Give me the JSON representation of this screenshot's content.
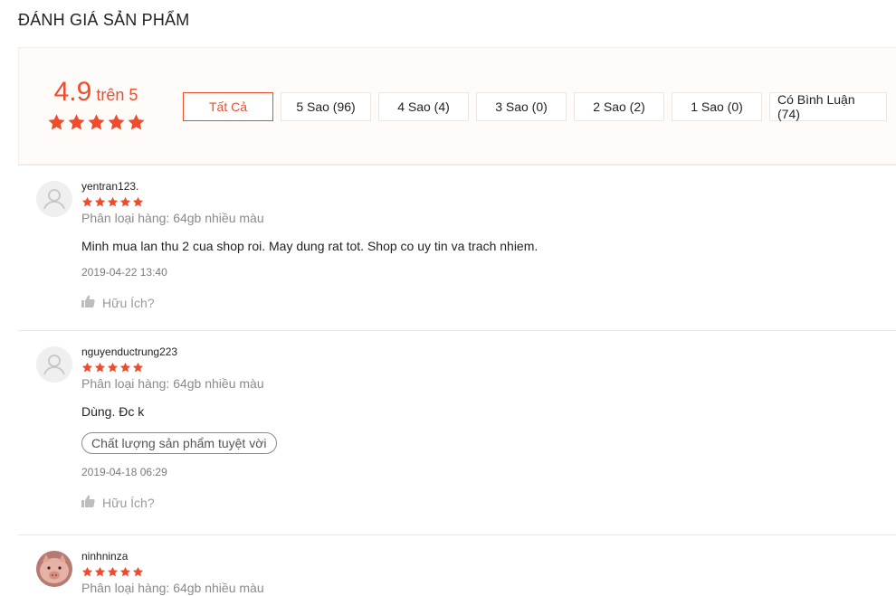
{
  "section_title": "ĐÁNH GIÁ SẢN PHẨM",
  "colors": {
    "accent": "#ee4d2d",
    "muted": "#8a8a8a",
    "border": "#e8e8e8"
  },
  "rating": {
    "score": "4.9",
    "out_of": "trên 5",
    "stars": 5
  },
  "filters": [
    {
      "label": "Tất Cả",
      "active": true
    },
    {
      "label": "5 Sao (96)",
      "active": false
    },
    {
      "label": "4 Sao (4)",
      "active": false
    },
    {
      "label": "3 Sao (0)",
      "active": false
    },
    {
      "label": "2 Sao (2)",
      "active": false
    },
    {
      "label": "1 Sao (0)",
      "active": false
    },
    {
      "label": "Có Bình Luận (74)",
      "active": false
    }
  ],
  "reviews": [
    {
      "username": "yentran123.",
      "stars": 5,
      "variant": "Phân loại hàng: 64gb nhiều màu",
      "comment": "Minh mua lan thu 2 cua shop roi. May dung rat tot. Shop co uy tin va trach nhiem.",
      "time": "2019-04-22 13:40",
      "helpful_label": "Hữu Ích?",
      "avatar_icon": "default-user-icon"
    },
    {
      "username": "nguyenductrung223",
      "stars": 5,
      "variant": "Phân loại hàng: 64gb nhiều màu",
      "comment": "Dùng. Đc k",
      "tag": "Chất lượng sản phẩm tuyệt vời",
      "time": "2019-04-18 06:29",
      "helpful_label": "Hữu Ích?",
      "avatar_icon": "default-user-icon"
    },
    {
      "username": "ninhninza",
      "stars": 5,
      "variant": "Phân loại hàng: 64gb nhiều màu",
      "avatar_icon": "pig-avatar-photo"
    }
  ]
}
